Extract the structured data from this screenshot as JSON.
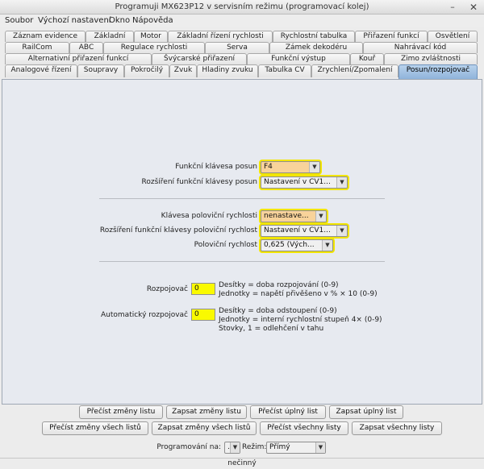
{
  "window": {
    "title": "Programuji MX623P12 v servisním režimu (programovací kolej)",
    "min_glyph": "–",
    "close_glyph": "✕"
  },
  "menu": [
    "Soubor",
    "Výchozí nastavení",
    "Okno",
    "Nápověda"
  ],
  "tabs": {
    "row1": [
      "Záznam evidence",
      "Základní",
      "Motor",
      "Základní řízení rychlosti",
      "Rychlostní tabulka",
      "Přiřazení funkcí",
      "Osvětlení"
    ],
    "row2": [
      "RailCom",
      "ABC",
      "Regulace rychlosti",
      "Serva",
      "Zámek dekodéru",
      "Nahrávací kód"
    ],
    "row3": [
      "Alternativní přiřazení funkcí",
      "Švýcarské přiřazení",
      "Funkční výstup",
      "Kouř",
      "Zimo zvláštnosti"
    ],
    "row4": [
      "Analogové řízení",
      "Soupravy",
      "Pokročilý",
      "Zvuk",
      "Hladiny zvuku",
      "Tabulka CV",
      "Zrychlení/Zpomalení",
      "Posun/rozpojovač"
    ],
    "active": "Posun/rozpojovač"
  },
  "shunting": {
    "function_key_label": "Funkční klávesa posun",
    "function_key_value": "F4",
    "function_key_ext_label": "Rozšíření funkční klávesy posun",
    "function_key_ext_value": "Nastavení v CV1...",
    "half_speed_key_label": "Klávesa poloviční rychlosti",
    "half_speed_key_value": "nenastave...",
    "half_speed_ext_label": "Rozšíření funkční klávesy poloviční rychlost",
    "half_speed_ext_value": "Nastavení v CV1...",
    "half_speed_label": "Poloviční rychlost",
    "half_speed_value": "0,625 (Vých..."
  },
  "uncoupler": {
    "label": "Rozpojovač",
    "value": "0",
    "desc": [
      "Desítky = doba rozpojování (0-9)",
      "Jednotky = napětí přivěšeno v % × 10 (0-9)"
    ]
  },
  "auto_uncoupler": {
    "label": "Automatický rozpojovač",
    "value": "0",
    "desc": [
      "Desítky = doba odstoupení (0-9)",
      "Jednotky = interní rychlostní stupeň 4× (0-9)",
      "Stovky, 1 = odlehčení v tahu"
    ]
  },
  "buttons": {
    "row1": [
      "Přečíst změny listu",
      "Zapsat změny listu",
      "Přečíst úplný list",
      "Zapsat úplný list"
    ],
    "row2": [
      "Přečíst změny všech listů",
      "Zapsat změny všech listů",
      "Přečíst všechny listy",
      "Zapsat všechny listy"
    ]
  },
  "programming": {
    "on_label": "Programování na:",
    "on_value": ".",
    "mode_label": "Režim:",
    "mode_value": "Přímý"
  },
  "status": "nečinný"
}
